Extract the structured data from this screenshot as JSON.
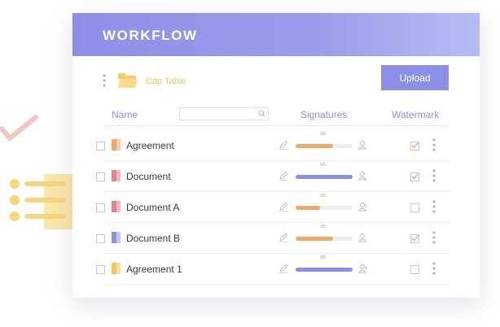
{
  "header": {
    "title": "WORKFLOW"
  },
  "toolbar": {
    "folder_label": "Cap Table",
    "upload_label": "Upload"
  },
  "columns": {
    "name": "Name",
    "signatures": "Signatures",
    "watermark": "Watermark"
  },
  "colors": {
    "accent": "#8c8fe6",
    "orange": "#f0a866",
    "purple": "#8c8fe6",
    "yellow": "#f0c95a"
  },
  "rows": [
    {
      "name": "Agreement",
      "icon": "orange-document-icon",
      "sig_count": "3/5",
      "progress": 0.66,
      "bar": "orange",
      "multi_signer": false,
      "watermark": true
    },
    {
      "name": "Document",
      "icon": "red-document-icon",
      "sig_count": "5/5",
      "progress": 1.0,
      "bar": "purple",
      "multi_signer": false,
      "watermark": true
    },
    {
      "name": "Document A",
      "icon": "red-document-icon",
      "sig_count": "2/5",
      "progress": 0.43,
      "bar": "orange",
      "multi_signer": true,
      "watermark": false
    },
    {
      "name": "Document B",
      "icon": "purple-document-icon",
      "sig_count": "3/5",
      "progress": 0.66,
      "bar": "orange",
      "multi_signer": false,
      "watermark": true
    },
    {
      "name": "Agreement 1",
      "icon": "yellow-document-icon",
      "sig_count": "5/5",
      "progress": 1.0,
      "bar": "purple",
      "multi_signer": true,
      "watermark": false
    }
  ]
}
